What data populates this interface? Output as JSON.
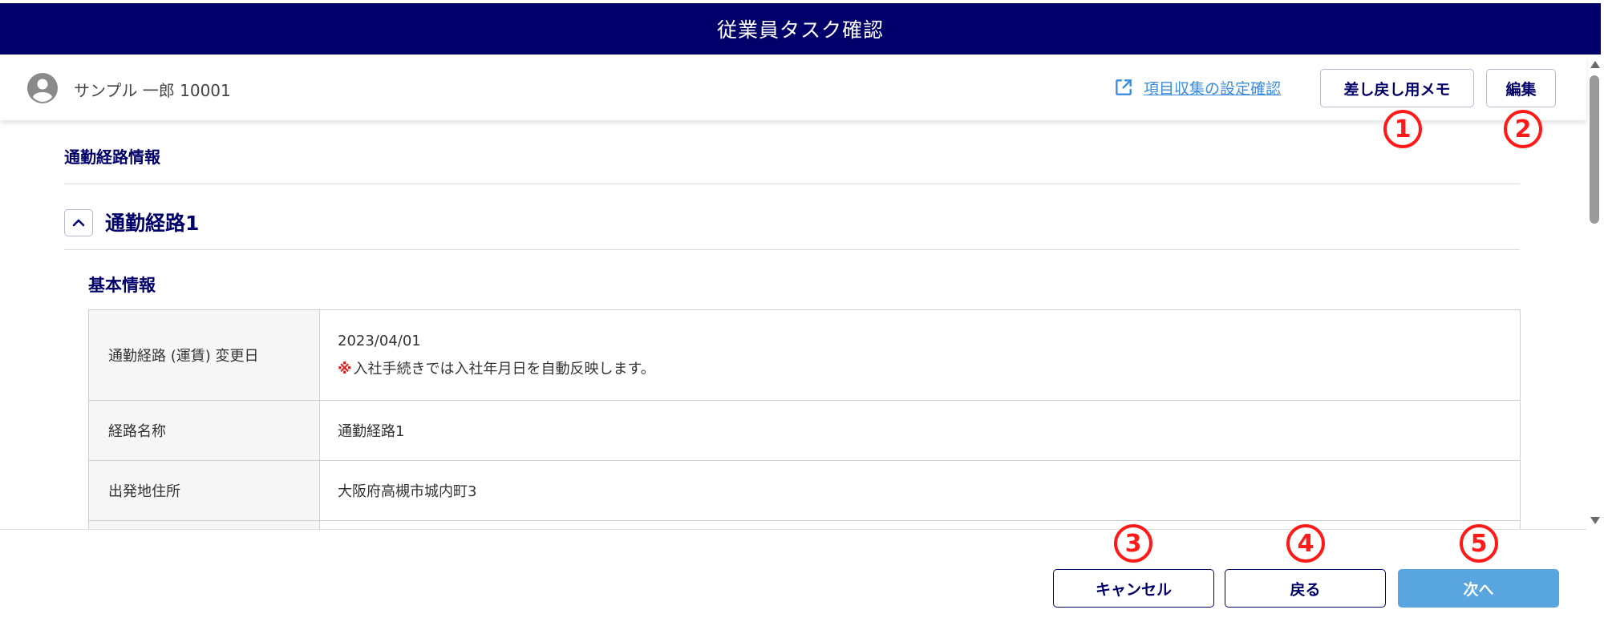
{
  "app": {
    "title": "従業員タスク確認"
  },
  "user": {
    "name": "サンプル 一郎 10001"
  },
  "header": {
    "settings_link": "項目収集の設定確認",
    "memo_button": "差し戻し用メモ",
    "edit_button": "編集"
  },
  "section": {
    "title": "通勤経路情報",
    "route_title": "通勤経路1",
    "subsection_title": "基本情報"
  },
  "table": {
    "rows": [
      {
        "label": "通勤経路 (運賃) 変更日",
        "value": "2023/04/01",
        "note_mark": "※",
        "note": "入社手続きでは入社年月日を自動反映します。"
      },
      {
        "label": "経路名称",
        "value": "通勤経路1"
      },
      {
        "label": "出発地住所",
        "value": "大阪府高槻市城内町3"
      }
    ]
  },
  "footer": {
    "cancel_button": "キャンセル",
    "back_button": "戻る",
    "next_button": "次へ"
  },
  "annotations": [
    "1",
    "2",
    "3",
    "4",
    "5"
  ],
  "colors": {
    "title_bar": "#01006b",
    "primary_text": "#01006b",
    "link": "#3b8be0",
    "next_button": "#58a5e0",
    "annotation": "#ff1a1a"
  }
}
